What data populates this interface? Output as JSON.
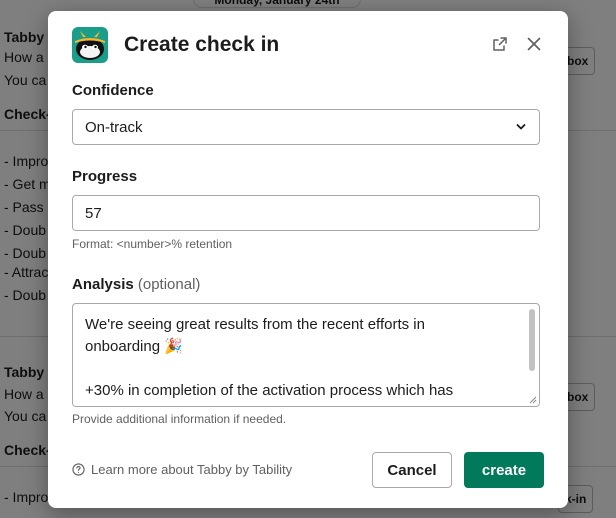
{
  "background": {
    "date_pill": "Monday, January 24th",
    "block1": {
      "author": "Tabby",
      "line1": "How a",
      "line2": "You ca",
      "section": "Check-",
      "items": [
        "- Impro",
        "- Get m",
        "- Pass",
        "- Doub",
        "- Doub",
        "- Attrac",
        "- Doub"
      ],
      "button": "box"
    },
    "block2": {
      "author": "Tabby",
      "line1": "How a",
      "line2": "You ca",
      "section": "Check-",
      "items": [
        "- Impro"
      ],
      "button": "box",
      "button2": "k-in"
    }
  },
  "modal": {
    "title": "Create check in",
    "confidence": {
      "label": "Confidence",
      "selected": "On-track"
    },
    "progress": {
      "label": "Progress",
      "value": "57",
      "hint": "Format: <number>% retention"
    },
    "analysis": {
      "label": "Analysis",
      "optional": "(optional)",
      "line1": "We're seeing great results from the recent efforts in",
      "line2": "onboarding 🎉",
      "line3": "+30% in completion of the activation process which has",
      "hint": "Provide additional information if needed."
    },
    "footer": {
      "learn_more": "Learn more about Tabby by Tability",
      "cancel": "Cancel",
      "create": "create"
    }
  },
  "colors": {
    "primary": "#007a5a",
    "logo_bg": "#1a9e8a",
    "logo_hat": "#f5b82e"
  },
  "icons": {
    "open_in_window": "external-link-icon",
    "close": "close-icon",
    "dropdown": "chevron-down-icon",
    "help": "question-circle-icon"
  }
}
